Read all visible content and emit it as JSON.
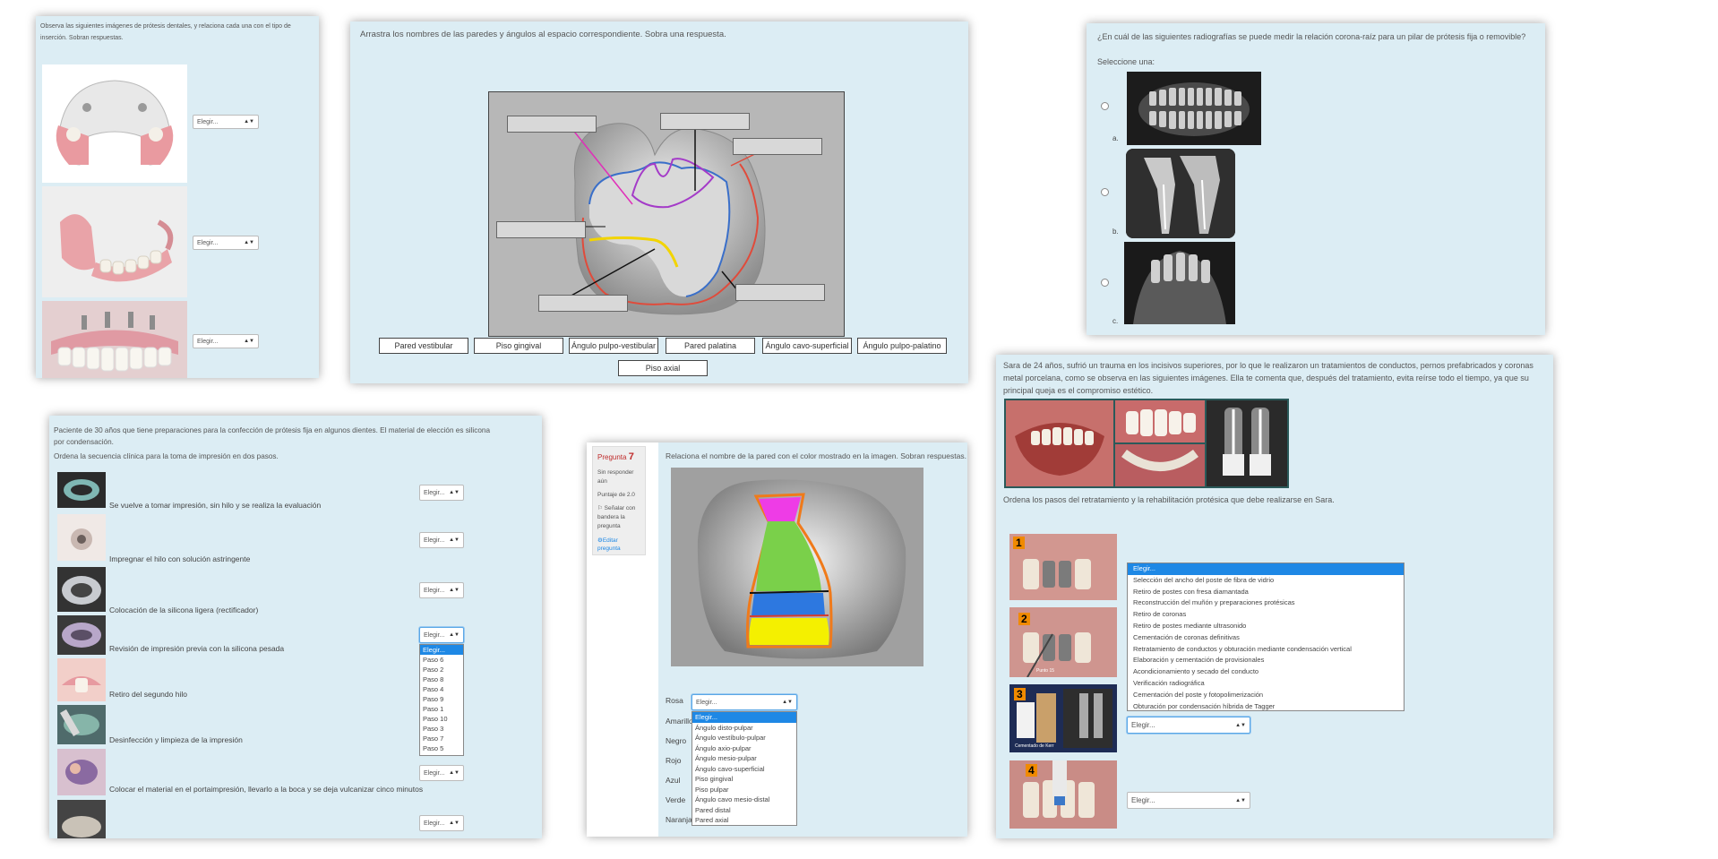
{
  "panel1": {
    "instruction": "Observa las siguientes imágenes de prótesis dentales, y relaciona cada una con el tipo de inserción. Sobran respuestas.",
    "selects": [
      "Elegir...",
      "Elegir...",
      "Elegir..."
    ]
  },
  "panel2": {
    "instruction": "Arrastra los nombres de las paredes y ángulos al espacio correspondiente. Sobra una respuesta.",
    "options": [
      "Pared vestibular",
      "Piso gingival",
      "Ángulo pulpo-vestibular",
      "Pared palatina",
      "Ángulo cavo-superficial",
      "Ángulo pulpo-palatino",
      "Piso axial"
    ]
  },
  "panel3": {
    "question": "¿En cuál de las siguientes radiografías se puede medir la relación corona-raíz para un pilar de prótesis fija o removible?",
    "prompt": "Seleccione una:",
    "choices": [
      "a.",
      "b.",
      "c."
    ]
  },
  "panel4": {
    "intro": "Paciente de 30 años que tiene preparaciones para la confección de prótesis fija en algunos dientes. El material de elección es silicona por condensación.",
    "instruction": "Ordena la secuencia clínica para la toma de impresión en dos pasos.",
    "rows": [
      {
        "label": "Se vuelve a tomar impresión, sin hilo y se realiza la evaluación",
        "select": "Elegir..."
      },
      {
        "label": "Impregnar el hilo con solución astringente",
        "select": "Elegir..."
      },
      {
        "label": "Colocación de la silicona ligera (rectificador)",
        "select": "Elegir..."
      },
      {
        "label": "Revisión de impresión previa con la silicona pesada",
        "select": "Elegir..."
      },
      {
        "label": "Retiro del segundo hilo",
        "select": ""
      },
      {
        "label": "Desinfección y limpieza de la impresión",
        "select": ""
      },
      {
        "label": "Colocar el material en el portaimpresión, llevarlo a la boca y se deja vulcanizar cinco minutos",
        "select": "Elegir..."
      },
      {
        "label": "",
        "select": "Elegir..."
      }
    ],
    "dropdown": [
      "Elegir...",
      "Paso 6",
      "Paso 2",
      "Paso 8",
      "Paso 4",
      "Paso 9",
      "Paso 1",
      "Paso 10",
      "Paso 3",
      "Paso 7",
      "Paso 5"
    ]
  },
  "panel5": {
    "sidebar": {
      "label": "Pregunta",
      "number": "7",
      "status": "Sin responder aún",
      "score": "Puntaje de 2.0",
      "flag": "Señalar con bandera la pregunta",
      "edit": "Editar pregunta"
    },
    "instruction": "Relaciona el nombre de la pared con el color mostrado en la imagen. Sobran respuestas.",
    "colors": [
      "Rosa",
      "Amarillo",
      "Negro",
      "Rojo",
      "Azul",
      "Verde",
      "Naranja"
    ],
    "select": "Elegir...",
    "dropdown": [
      "Elegir...",
      "Ángulo disto-pulpar",
      "Ángulo vestíbulo-pulpar",
      "Ángulo axio-pulpar",
      "Ángulo mesio-pulpar",
      "Ángulo cavo-superficial",
      "Piso gingival",
      "Piso pulpar",
      "Ángulo cavo mesio-distal",
      "Pared distal",
      "Pared axial"
    ]
  },
  "panel6": {
    "intro": "Sara de 24 años, sufrió un trauma en los incisivos superiores, por lo que le realizaron un tratamientos de conductos, pernos prefabricados y coronas metal porcelana, como se observa en las siguientes imágenes. Ella te comenta que, después del tratamiento, evita reírse todo el tiempo, ya que su principal queja es el compromiso estético.",
    "instruction": "Ordena los pasos del retratamiento y la rehabilitación protésica que debe realizarse en Sara.",
    "steps": [
      "1",
      "2",
      "3",
      "4"
    ],
    "photo_caption": "Punto 15",
    "photo3_caption": "Cementado de Kerr",
    "select": "Elegir...",
    "dropdown": [
      "Elegir...",
      "Selección del ancho del poste de fibra de vidrio",
      "Retiro de postes con fresa diamantada",
      "Reconstrucción del muñón y preparaciones protésicas",
      "Retiro de coronas",
      "Retiro de postes mediante ultrasonido",
      "Cementación de coronas definitivas",
      "Retratamiento de conductos y obturación mediante condensación vertical",
      "Elaboración y cementación de provisionales",
      "Acondicionamiento y secado del conducto",
      "Verificación radiográfica",
      "Cementación del poste y fotopolimerización",
      "Obturación por condensación híbrida de Tagger"
    ]
  }
}
